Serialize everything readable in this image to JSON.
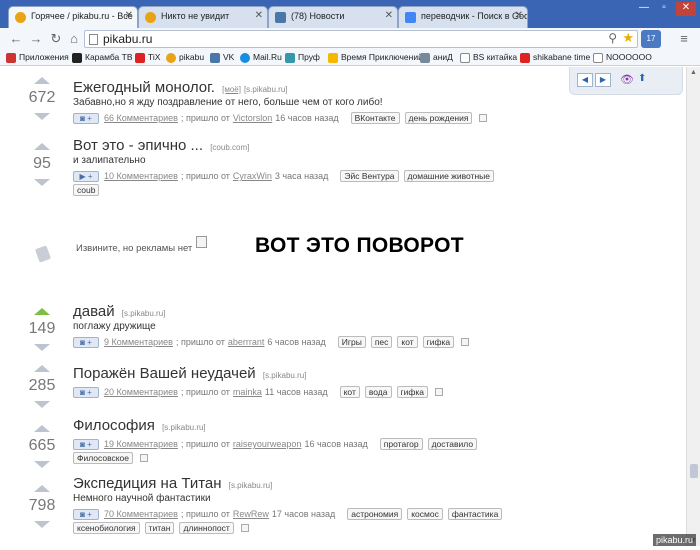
{
  "browser": {
    "tabs": [
      {
        "title": "Горячее / pikabu.ru - Все",
        "icon": "pikabu-icon"
      },
      {
        "title": "Никто не увидит",
        "icon": "pikabu-icon"
      },
      {
        "title": "(78) Новости",
        "icon": "vk-icon"
      },
      {
        "title": "переводчик - Поиск в Goo",
        "icon": "google-icon"
      }
    ],
    "url": "pikabu.ru",
    "extension_badge": "17"
  },
  "bookmarks": [
    "Приложения",
    "Карамба ТВ",
    "TiX",
    "pikabu",
    "VK",
    "Mail.Ru",
    "Пруф",
    "Время Приключений",
    "аниД",
    "BS китайка",
    "shikabane time",
    "NOOOOOO"
  ],
  "posts": [
    {
      "rating": "672",
      "title": "Ежегодный монолог.",
      "mine": "[моё]",
      "source": "[s.pikabu.ru]",
      "description": "Забавно,но я жду поздравление от него, больше чем от кого либо!",
      "comments": "66 Комментариев",
      "meta_sep": "; пришло от",
      "author": "Victorslon",
      "time": "16 часов назад",
      "tags": [
        "ВКонтакте",
        "день рождения"
      ]
    },
    {
      "rating": "95",
      "title": "Вот это - эпично ...",
      "source": "[coub.com]",
      "description": "и залипательно",
      "comments": "10 Комментариев",
      "meta_sep": "; пришло от",
      "author": "CyraxWin",
      "time": "3 часа назад",
      "tags": [
        "Эйс Вентура",
        "домашние животные",
        "coub"
      ]
    },
    {
      "rating": "149",
      "title": "давай",
      "source": "[s.pikabu.ru]",
      "description": "поглажу дружище",
      "comments": "9 Комментариев",
      "meta_sep": "; пришло от",
      "author": "aberrrant",
      "time": "6 часов назад",
      "tags": [
        "Игры",
        "пес",
        "кот",
        "гифка"
      ]
    },
    {
      "rating": "285",
      "title": "Поражён Вашей неудачей",
      "source": "[s.pikabu.ru]",
      "description": "",
      "comments": "20 Комментариев",
      "meta_sep": "; пришло от",
      "author": "mainka",
      "time": "11 часов назад",
      "tags": [
        "кот",
        "вода",
        "гифка"
      ]
    },
    {
      "rating": "665",
      "title": "Философия",
      "source": "[s.pikabu.ru]",
      "description": "",
      "comments": "19 Комментариев",
      "meta_sep": "; пришло от",
      "author": "raiseyourweapon",
      "time": "16 часов назад",
      "tags": [
        "протагор",
        "доставило",
        "Филосовское"
      ]
    },
    {
      "rating": "798",
      "title": "Экспедиция на Титан",
      "source": "[s.pikabu.ru]",
      "description": "Немного научной фантастики",
      "comments": "70 Комментариев",
      "meta_sep": "; пришло от",
      "author": "RewRew",
      "time": "17 часов назад",
      "tags": [
        "астрономия",
        "космос",
        "фантастика",
        "ксенобиология",
        "титан",
        "длиннопост"
      ]
    }
  ],
  "ad": {
    "note": "Извините, но рекламы нет",
    "caption": "ВОТ ЭТО ПОВОРОТ"
  },
  "watermark": "pikabu.ru",
  "colors": {
    "tabstrip": "#3a64b4",
    "upvote_active": "#7bc043",
    "vote_arrow": "#bcc5cf"
  }
}
